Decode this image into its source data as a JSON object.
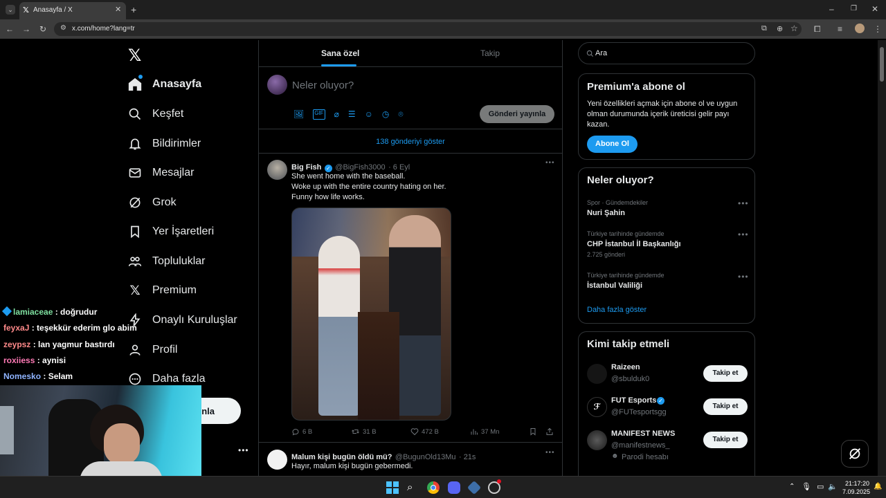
{
  "browser": {
    "tab_title": "Anasayfa / X",
    "url": "x.com/home?lang=tr"
  },
  "sidebar": {
    "items": [
      {
        "label": "Anasayfa",
        "icon": "home-icon"
      },
      {
        "label": "Keşfet",
        "icon": "search-icon"
      },
      {
        "label": "Bildirimler",
        "icon": "bell-icon"
      },
      {
        "label": "Mesajlar",
        "icon": "envelope-icon"
      },
      {
        "label": "Grok",
        "icon": "grok-icon"
      },
      {
        "label": "Yer İşaretleri",
        "icon": "bookmark-icon"
      },
      {
        "label": "Topluluklar",
        "icon": "people-icon"
      },
      {
        "label": "Premium",
        "icon": "x-logo-icon"
      },
      {
        "label": "Onaylı Kuruluşlar",
        "icon": "lightning-icon"
      },
      {
        "label": "Profil",
        "icon": "user-icon"
      },
      {
        "label": "Daha fazla",
        "icon": "more-circle-icon"
      }
    ],
    "post_button": "nla"
  },
  "main": {
    "tabs": [
      "Sana özel",
      "Takip"
    ],
    "compose_placeholder": "Neler oluyor?",
    "compose_button": "Gönderi yayınla",
    "show_more": "138 gönderiyi göster",
    "tweets": [
      {
        "name": "Big Fish",
        "handle": "@BigFish3000",
        "time": "· 6 Eyl",
        "lines": [
          "She went home with the baseball.",
          "Woke up with the entire country hating on her.",
          "Funny how life works."
        ],
        "replies": "6 B",
        "retweets": "31 B",
        "likes": "472 B",
        "views": "37 Mn"
      },
      {
        "name": "Malum kişi bugün öldü mü?",
        "handle": "@BugunOld13Mu",
        "time": "· 21s",
        "lines": [
          "Hayır, malum kişi bugün gebermedi."
        ]
      }
    ]
  },
  "right": {
    "search_placeholder": "Ara",
    "premium": {
      "title": "Premium'a abone ol",
      "body": [
        "Yeni özellikleri açmak için abone ol ve uygun",
        "olman durumunda içerik üreticisi gelir payı",
        "kazan."
      ],
      "button": "Abone Ol"
    },
    "trends": {
      "title": "Neler oluyor?",
      "items": [
        {
          "category": "Spor · Gündemdekiler",
          "name": "Nuri Şahin",
          "count": ""
        },
        {
          "category": "Türkiye tarihinde gündemde",
          "name": "CHP İstanbul İl Başkanlığı",
          "count": "2.725 gönderi"
        },
        {
          "category": "Türkiye tarihinde gündemde",
          "name": "İstanbul Valiliği",
          "count": ""
        }
      ],
      "more": "Daha fazla göster"
    },
    "who_to_follow": {
      "title": "Kimi takip etmeli",
      "users": [
        {
          "name": "Raizeen",
          "handle": "@sbulduk0",
          "extra": ""
        },
        {
          "name": "FUT Esports",
          "handle": "@FUTesportsgg",
          "extra": ""
        },
        {
          "name": "MANIFEST NEWS",
          "handle": "@manifestnews_",
          "extra": "Parodi hesabı"
        }
      ],
      "button": "Takip et"
    }
  },
  "chat": [
    {
      "user": "lamiaceae",
      "msg": " : doğrudur",
      "color": "#7fe0a0"
    },
    {
      "user": "feyxaJ",
      "msg": " : teşekkür ederim glo abim",
      "color": "#ff8a8a"
    },
    {
      "user": "zeypsz",
      "msg": " : lan yagmur bastırdı",
      "color": "#ff8a8a"
    },
    {
      "user": "roxiiess",
      "msg": " : aynisi",
      "color": "#ff7ab6"
    },
    {
      "user": "Nomesko",
      "msg": " : Selam",
      "color": "#8fb4ff"
    }
  ],
  "taskbar": {
    "time": "21:17:20",
    "date": "7.09.2025"
  }
}
